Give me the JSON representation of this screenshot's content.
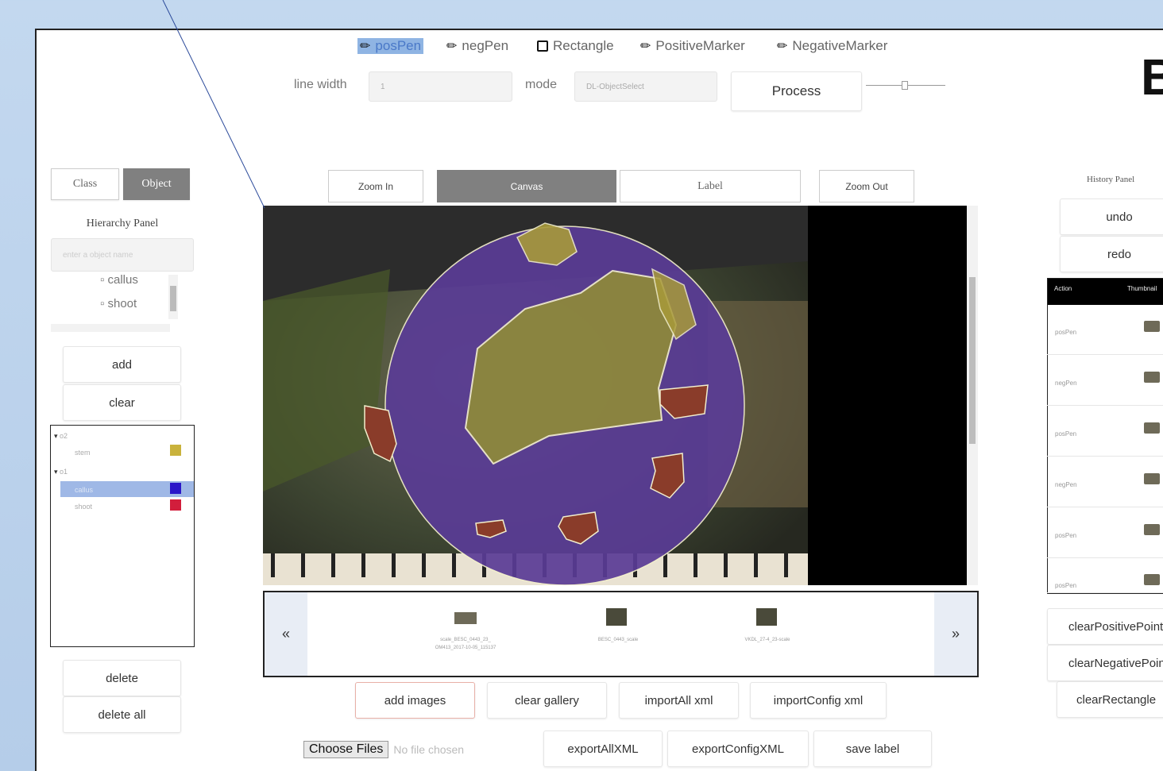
{
  "toolbar": {
    "tools": [
      {
        "name": "posPen",
        "selected": true
      },
      {
        "name": "negPen",
        "selected": false
      },
      {
        "name": "Rectangle",
        "selected": false
      },
      {
        "name": "PositiveMarker",
        "selected": false
      },
      {
        "name": "NegativeMarker",
        "selected": false
      }
    ],
    "line_width_label": "line width",
    "line_width_value": "1",
    "mode_label": "mode",
    "mode_value": "DL-ObjectSelect",
    "process_label": "Process",
    "slider_level": 0.5,
    "big_letter": "B"
  },
  "left_panel": {
    "tab_class": "Class",
    "tab_object": "Object",
    "hierarchy_title": "Hierarchy Panel",
    "name_placeholder": "enter a object name",
    "list_items": [
      "callus",
      "shoot"
    ],
    "add_label": "add",
    "clear_label": "clear",
    "tree": [
      {
        "group": "o2",
        "children": [
          {
            "name": "stem",
            "color": "#c9b23c",
            "selected": false
          }
        ]
      },
      {
        "group": "o1",
        "children": [
          {
            "name": "callus",
            "color": "#2a16c8",
            "selected": true
          },
          {
            "name": "shoot",
            "color": "#d21e3c",
            "selected": false
          }
        ]
      }
    ],
    "delete_label": "delete",
    "delete_all_label": "delete all"
  },
  "view_tabs": {
    "zoom_in": "Zoom In",
    "canvas": "Canvas",
    "label": "Label",
    "zoom_out": "Zoom Out"
  },
  "gallery": {
    "prev": "«",
    "next": "»",
    "items": [
      {
        "caption": "scale_BESC_0443_23_ OM413_2017-10-05_115137"
      },
      {
        "caption": "BESC_0443_scale"
      },
      {
        "caption": "VKDL_27-4_23-scale"
      }
    ]
  },
  "actions_row1": [
    "add images",
    "clear gallery",
    "importAll xml",
    "importConfig xml"
  ],
  "actions_row2": [
    "exportAllXML",
    "exportConfigXML",
    "save label"
  ],
  "file_input": {
    "button": "Choose Files",
    "status": "No file chosen"
  },
  "history": {
    "title": "History Panel",
    "undo_label": "undo",
    "redo_label": "redo",
    "col_action": "Action",
    "col_thumb": "Thumbnail",
    "rows": [
      "posPen",
      "negPen",
      "posPen",
      "negPen",
      "posPen",
      "posPen"
    ],
    "clear_positive": "clearPositivePoints",
    "clear_negative": "clearNegativePoints",
    "clear_rectangle": "clearRectangle"
  },
  "colors": {
    "accent_gray": "#808080",
    "selected_tool_bg": "#8fb4e3",
    "tree_selected_bg": "#9fb8e6"
  }
}
